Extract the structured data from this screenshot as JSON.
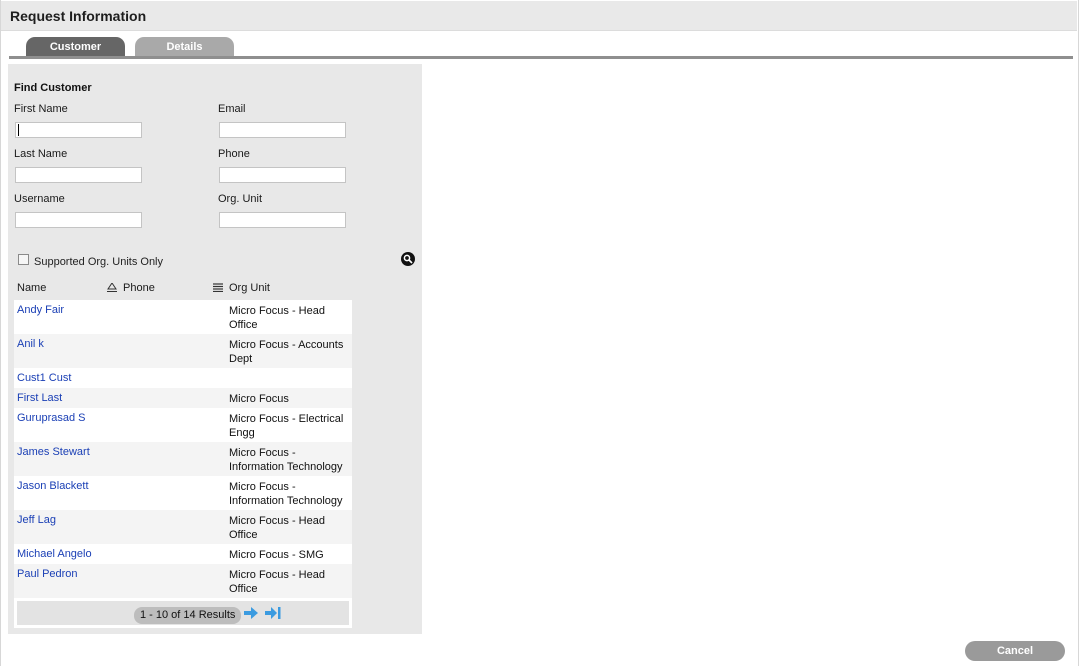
{
  "header": {
    "title": "Request Information"
  },
  "tabs": [
    {
      "label": "Customer",
      "active": true
    },
    {
      "label": "Details",
      "active": false
    }
  ],
  "find": {
    "title": "Find Customer",
    "fields": {
      "first_name": {
        "label": "First Name",
        "value": ""
      },
      "email": {
        "label": "Email",
        "value": ""
      },
      "last_name": {
        "label": "Last Name",
        "value": ""
      },
      "phone": {
        "label": "Phone",
        "value": ""
      },
      "username": {
        "label": "Username",
        "value": ""
      },
      "org_unit": {
        "label": "Org. Unit",
        "value": ""
      }
    },
    "supported_only": {
      "label": "Supported Org. Units Only",
      "checked": false
    },
    "search_icon": "search-icon"
  },
  "table": {
    "columns": [
      "Name",
      "Phone",
      "Org Unit"
    ],
    "rows": [
      {
        "name": "Andy Fair",
        "phone": "",
        "org": "Micro Focus - Head Office"
      },
      {
        "name": "Anil k",
        "phone": "",
        "org": "Micro Focus - Accounts Dept"
      },
      {
        "name": "Cust1 Cust",
        "phone": "",
        "org": ""
      },
      {
        "name": "First Last",
        "phone": "",
        "org": "Micro Focus"
      },
      {
        "name": "Guruprasad S",
        "phone": "",
        "org": "Micro Focus - Electrical Engg"
      },
      {
        "name": "James Stewart",
        "phone": "",
        "org": "Micro Focus - Information Technology"
      },
      {
        "name": "Jason Blackett",
        "phone": "",
        "org": "Micro Focus - Information Technology"
      },
      {
        "name": "Jeff Lag",
        "phone": "",
        "org": "Micro Focus - Head Office"
      },
      {
        "name": "Michael Angelo",
        "phone": "",
        "org": "Micro Focus - SMG"
      },
      {
        "name": "Paul Pedron",
        "phone": "",
        "org": "Micro Focus - Head Office"
      }
    ]
  },
  "pager": {
    "summary": "1 - 10 of 14 Results",
    "next_icon": "arrow-right-icon",
    "last_icon": "arrow-last-icon"
  },
  "footer": {
    "cancel_label": "Cancel"
  },
  "colors": {
    "link": "#1a3fb5",
    "panel": "#e8e8e8",
    "tab_active": "#666666",
    "tab_inactive": "#a9a9a9"
  }
}
